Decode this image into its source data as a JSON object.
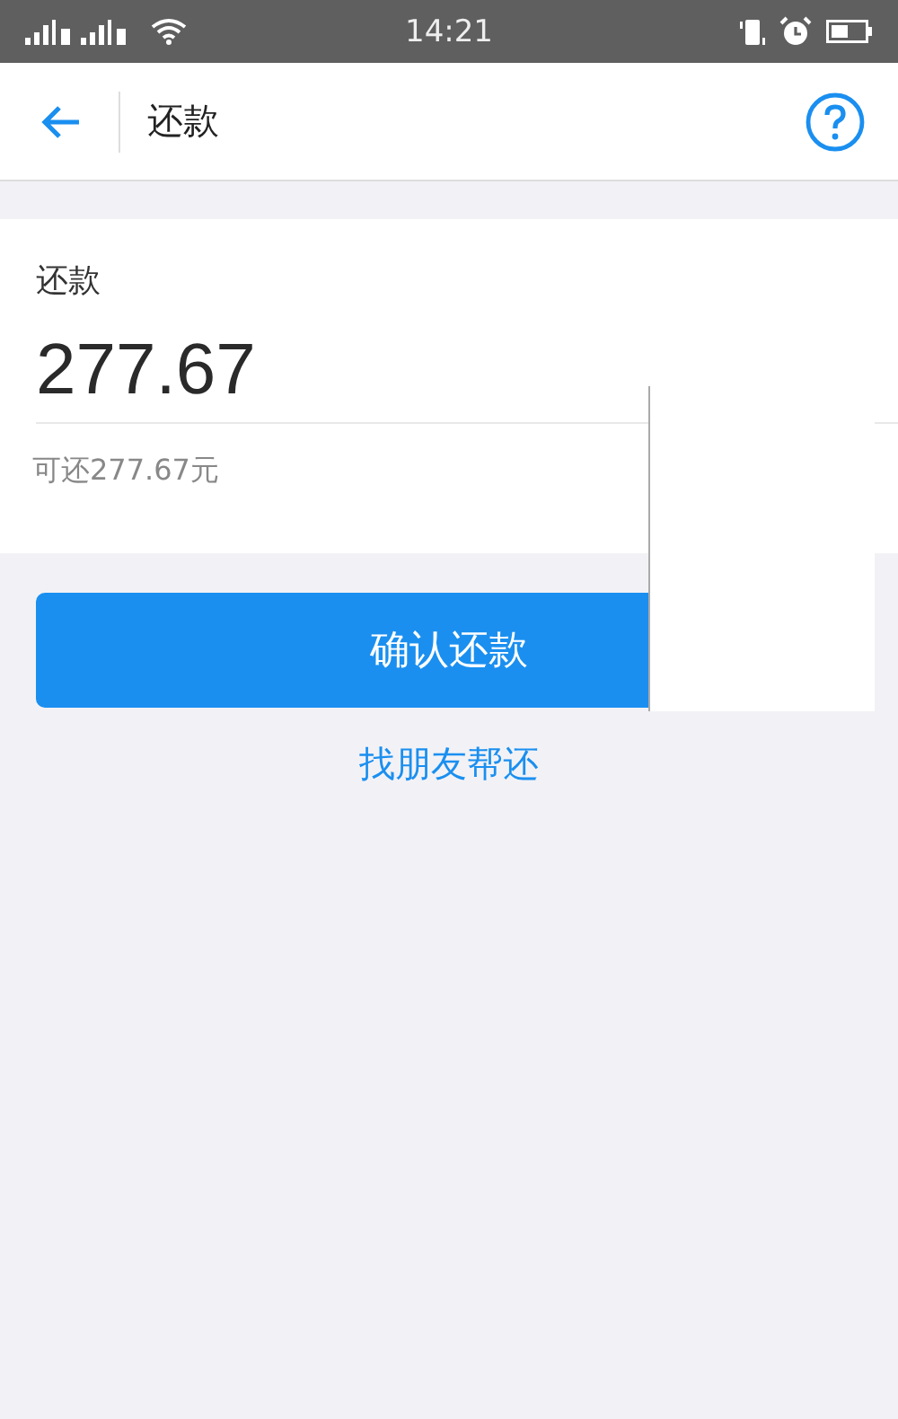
{
  "status_bar": {
    "time": "14:21"
  },
  "header": {
    "title": "还款"
  },
  "card": {
    "label": "还款",
    "amount": "277.67",
    "hint": "可还277.67元"
  },
  "confirm_button": "确认还款",
  "friend_link": "找朋友帮还"
}
